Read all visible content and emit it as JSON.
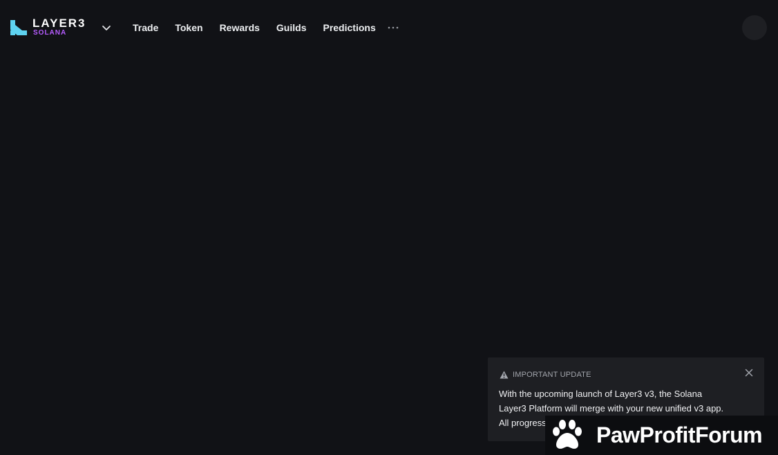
{
  "brand": {
    "name": "LAYER3",
    "network": "SOLANA",
    "network_color": "#b65cff",
    "mark_color": "#5ed2f0",
    "mark_icon": "layer3-logo"
  },
  "nav": {
    "items": [
      {
        "label": "Trade"
      },
      {
        "label": "Token"
      },
      {
        "label": "Rewards"
      },
      {
        "label": "Guilds"
      },
      {
        "label": "Predictions"
      }
    ],
    "more_icon": "more-horizontal-icon",
    "network_dropdown_icon": "chevron-down-icon"
  },
  "user": {
    "avatar_icon": "avatar"
  },
  "toast": {
    "title": "IMPORTANT UPDATE",
    "icon": "warning-icon",
    "close_icon": "close-icon",
    "lines": [
      "With the upcoming launch of Layer3 v3, the Solana",
      "Layer3 Platform will merge with your new unified v3 app.",
      "All progress"
    ]
  },
  "watermark": {
    "text": "PawProfitForum",
    "icon": "paw-icon"
  },
  "colors": {
    "background": "#111216",
    "panel": "#1e1f23",
    "text": "#eef0f2",
    "muted": "#a3a6ad"
  }
}
